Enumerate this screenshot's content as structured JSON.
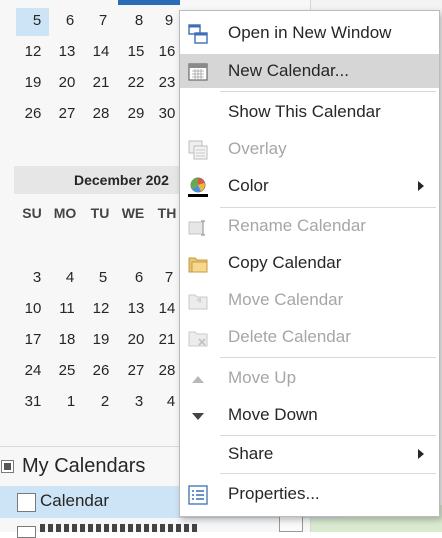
{
  "calendar_nav": {
    "prev_month_rows": [
      [
        "5",
        "6",
        "7",
        "8",
        "9"
      ],
      [
        "12",
        "13",
        "14",
        "15",
        "16"
      ],
      [
        "19",
        "20",
        "21",
        "22",
        "23"
      ],
      [
        "26",
        "27",
        "28",
        "29",
        "30"
      ]
    ],
    "month_title": "December 202",
    "weekday_headers": [
      "SU",
      "MO",
      "TU",
      "WE",
      "TH"
    ],
    "next_month_rows": [
      [
        "3",
        "4",
        "5",
        "6",
        "7"
      ],
      [
        "10",
        "11",
        "12",
        "13",
        "14"
      ],
      [
        "17",
        "18",
        "19",
        "20",
        "21"
      ],
      [
        "24",
        "25",
        "26",
        "27",
        "28"
      ],
      [
        "31",
        "1",
        "2",
        "3",
        "4"
      ]
    ]
  },
  "folder_pane": {
    "group_title": "My Calendars",
    "calendar_label": "Calendar"
  },
  "context_menu": {
    "items": [
      {
        "label": "Open in New Window",
        "icon": "open-new-window-icon",
        "enabled": true
      },
      {
        "label": "New Calendar...",
        "icon": "new-calendar-icon",
        "enabled": true,
        "highlighted": true
      },
      {
        "label": "Show This Calendar",
        "icon": "",
        "enabled": true
      },
      {
        "label": "Overlay",
        "icon": "overlay-icon",
        "enabled": false
      },
      {
        "label": "Color",
        "icon": "color-palette-icon",
        "enabled": true,
        "submenu": true
      },
      {
        "label": "Rename Calendar",
        "icon": "rename-icon",
        "enabled": false
      },
      {
        "label": "Copy Calendar",
        "icon": "copy-folder-icon",
        "enabled": true
      },
      {
        "label": "Move Calendar",
        "icon": "move-folder-icon",
        "enabled": false
      },
      {
        "label": "Delete Calendar",
        "icon": "delete-folder-icon",
        "enabled": false
      },
      {
        "label": "Move Up",
        "icon": "triangle-up-icon",
        "enabled": false
      },
      {
        "label": "Move Down",
        "icon": "triangle-down-icon",
        "enabled": true
      },
      {
        "label": "Share",
        "icon": "",
        "enabled": true,
        "submenu": true
      },
      {
        "label": "Properties...",
        "icon": "properties-icon",
        "enabled": true
      }
    ]
  },
  "colors": {
    "selection": "#cde4f7",
    "menu_highlight": "#d6d6d6",
    "accent": "#2b6cb7",
    "disabled_text": "#a6a6a6"
  }
}
